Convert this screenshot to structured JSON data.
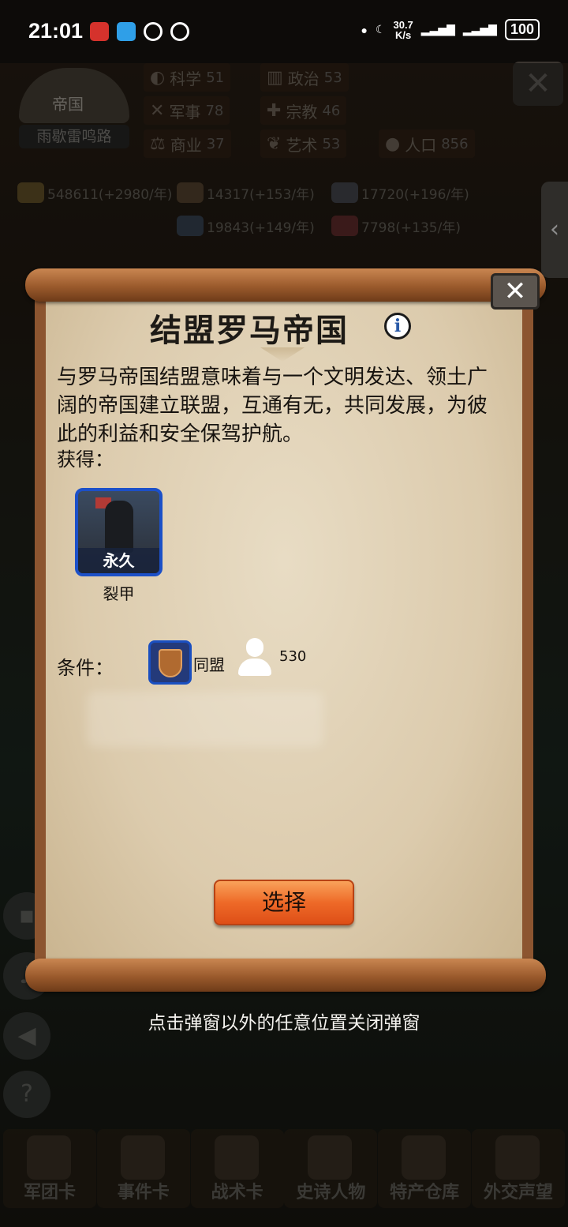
{
  "status_bar": {
    "time": "21:01",
    "net_speed_value": "30.7",
    "net_speed_unit": "K/s",
    "battery": "100"
  },
  "background": {
    "empire_title": "帝国",
    "player_name": "雨歇雷鸣路",
    "stats": [
      {
        "label": "科学",
        "value": "51",
        "icon": "planet-icon"
      },
      {
        "label": "政治",
        "value": "53",
        "icon": "building-icon"
      },
      {
        "label": "军事",
        "value": "78",
        "icon": "swords-icon"
      },
      {
        "label": "宗教",
        "value": "46",
        "icon": "cross-icon"
      },
      {
        "label": "商业",
        "value": "37",
        "icon": "scale-icon"
      },
      {
        "label": "艺术",
        "value": "53",
        "icon": "laurel-icon"
      },
      {
        "label": "人口",
        "value": "856",
        "icon": "person-icon"
      }
    ],
    "resources": [
      {
        "text": "548611(+2980/年)",
        "icon": "gold-icon"
      },
      {
        "text": "14317(+153/年)",
        "icon": "wood-icon"
      },
      {
        "text": "17720(+196/年)",
        "icon": "stone-icon"
      },
      {
        "text": "19843(+149/年)",
        "icon": "iron-icon"
      },
      {
        "text": "7798(+135/年)",
        "icon": "meat-icon"
      }
    ],
    "nav": [
      "军团卡",
      "事件卡",
      "战术卡",
      "史诗人物",
      "特产仓库",
      "外交声望"
    ]
  },
  "dialog": {
    "title": "结盟罗马帝国",
    "description": "与罗马帝国结盟意味着与一个文明发达、领土广阔的帝国建立联盟，互通有无，共同发展，为彼此的利益和安全保驾护航。",
    "gain_label": "获得：",
    "reward": {
      "badge": "永久",
      "name": "裂甲"
    },
    "condition_label": "条件：",
    "condition_type": "同盟",
    "population_required": "530",
    "choose_button": "选择"
  },
  "hint": "点击弹窗以外的任意位置关闭弹窗",
  "colors": {
    "button_orange": "#ee6a28",
    "card_blue": "#1c50c8",
    "scroll_wood": "#9a5a2c",
    "parchment": "#e8dcc4"
  }
}
